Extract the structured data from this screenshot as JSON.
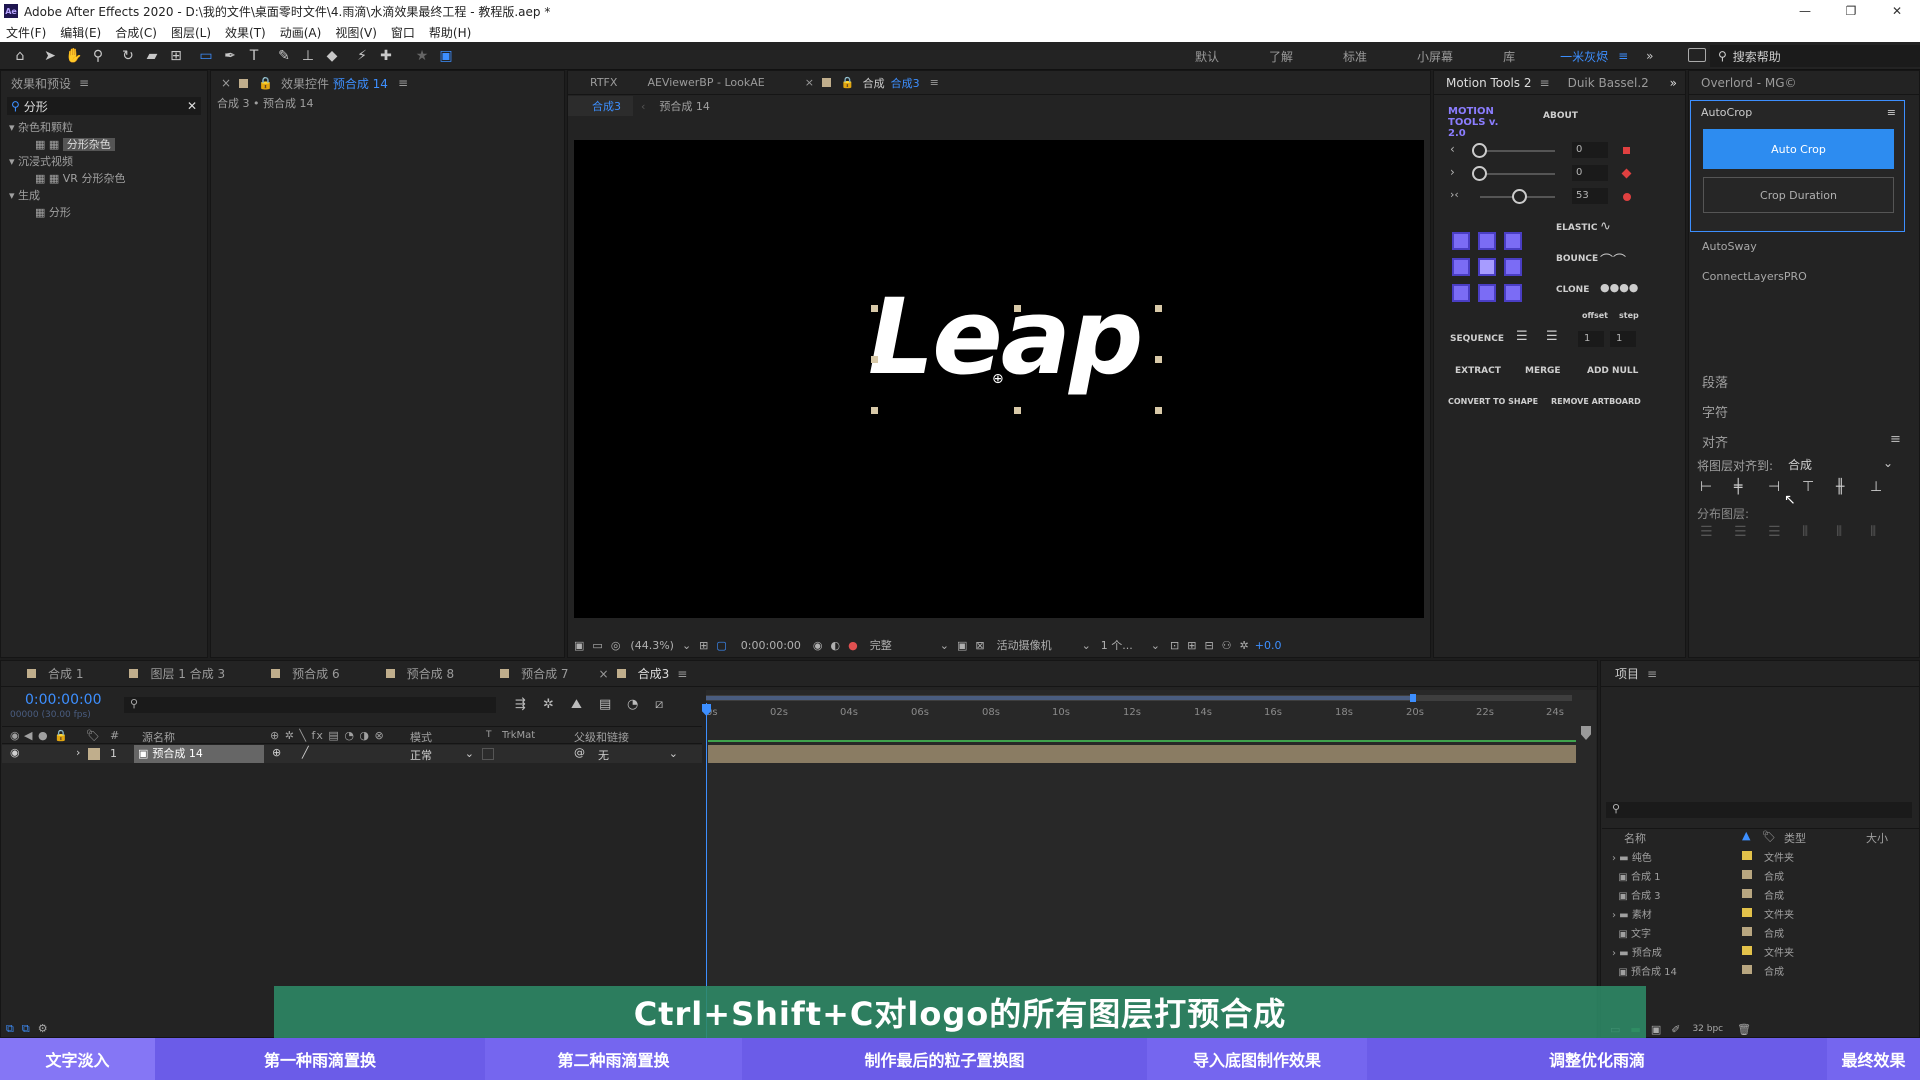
{
  "window": {
    "title": "Adobe After Effects 2020 - D:\\我的文件\\桌面零时文件\\4.雨滴\\水滴效果最终工程 - 教程版.aep *",
    "logo": "Ae",
    "controls": [
      "—",
      "❐",
      "✕"
    ]
  },
  "menu": [
    "文件(F)",
    "编辑(E)",
    "合成(C)",
    "图层(L)",
    "效果(T)",
    "动画(A)",
    "视图(V)",
    "窗口",
    "帮助(H)"
  ],
  "workspaces": {
    "items": [
      "默认",
      "了解",
      "标准",
      "小屏幕",
      "库"
    ],
    "active": "一米灰烬",
    "search": "搜索帮助"
  },
  "effects_panel": {
    "title": "效果和预设",
    "search_value": "分形",
    "tree": [
      {
        "label": "杂色和颗粒",
        "level": 0
      },
      {
        "label": "分形杂色",
        "level": 1,
        "selected": true
      },
      {
        "label": "沉浸式视频",
        "level": 0
      },
      {
        "label": "VR 分形杂色",
        "level": 1
      },
      {
        "label": "生成",
        "level": 0
      },
      {
        "label": "分形",
        "level": 1
      }
    ]
  },
  "effect_controls": {
    "title": "效果控件",
    "title_target": "预合成 14",
    "breadcrumb": "合成 3 • 预合成 14"
  },
  "viewer": {
    "tabs": [
      "RTFX",
      "AEViewerBP - LookAE",
      "合成",
      "合成3"
    ],
    "subtabs": [
      "合成3",
      "预合成 14"
    ],
    "logo_text": "Leap",
    "zoom": "(44.3%)",
    "timecode": "0:00:00:00",
    "quality": "完整",
    "camera": "活动摄像机",
    "views": "1 个...",
    "exposure": "+0.0"
  },
  "motion_tools": {
    "tabs": [
      "Motion Tools 2",
      "Duik Bassel.2"
    ],
    "brand": "MOTION TOOLS v. 2.0",
    "about": "ABOUT",
    "sliders": [
      {
        "value": "0"
      },
      {
        "value": "0"
      },
      {
        "value": "53"
      }
    ],
    "elastic": "ELASTIC",
    "bounce": "BOUNCE",
    "clone": "CLONE",
    "offset": "offset",
    "step": "step",
    "sequence": "SEQUENCE",
    "seq_values": [
      "1",
      "1"
    ],
    "extract": "EXTRACT",
    "merge": "MERGE",
    "add_null": "ADD NULL",
    "convert": "CONVERT TO SHAPE",
    "remove_artboard": "REMOVE ARTBOARD"
  },
  "right_panel": {
    "title": "Overlord - MG©",
    "autocrop": "AutoCrop",
    "autocrop_btn": "Auto Crop",
    "crop_duration": "Crop Duration",
    "autosway": "AutoSway",
    "connect": "ConnectLayersPRO",
    "paragraph": "段落",
    "character": "字符",
    "align": "对齐",
    "align_to_label": "将图层对齐到:",
    "align_to_value": "合成",
    "distribute": "分布图层:"
  },
  "timeline": {
    "tabs": [
      "合成 1",
      "图层 1 合成 3",
      "预合成 6",
      "预合成 8",
      "预合成 7",
      "合成3"
    ],
    "timecode": "0:00:00:00",
    "fps": "00000 (30.00 fps)",
    "columns": [
      "源名称",
      "模式",
      "T",
      "TrkMat",
      "父级和链接"
    ],
    "layer": {
      "index": "1",
      "name": "预合成 14",
      "mode": "正常",
      "parent": "无"
    },
    "ticks": [
      "0s",
      "02s",
      "04s",
      "06s",
      "08s",
      "10s",
      "12s",
      "14s",
      "16s",
      "18s",
      "20s",
      "22s",
      "24s"
    ]
  },
  "project": {
    "title": "项目",
    "columns": [
      "名称",
      "类型",
      "大小"
    ],
    "rows": [
      {
        "name": "纯色",
        "type": "文件夹"
      },
      {
        "name": "合成 1",
        "type": "合成"
      },
      {
        "name": "合成 3",
        "type": "合成"
      },
      {
        "name": "素材",
        "type": "文件夹"
      },
      {
        "name": "文字",
        "type": "合成"
      },
      {
        "name": "预合成",
        "type": "文件夹"
      },
      {
        "name": "预合成 14",
        "type": "合成"
      }
    ],
    "bpc": "32 bpc"
  },
  "subtitle": "Ctrl+Shift+C对logo的所有图层打预合成",
  "chapters": [
    "文字淡入",
    "第一种雨滴置换",
    "第二种雨滴置换",
    "制作最后的粒子置换图",
    "导入底图制作效果",
    "调整优化雨滴",
    "最终效果"
  ],
  "colors": {
    "accent": "#3d8fff",
    "purple": "#7b6cf5",
    "subtitle_bg": "#2e8a66",
    "chapter_bg": "#6b5ce8",
    "chapter_active": "#8576f5"
  }
}
